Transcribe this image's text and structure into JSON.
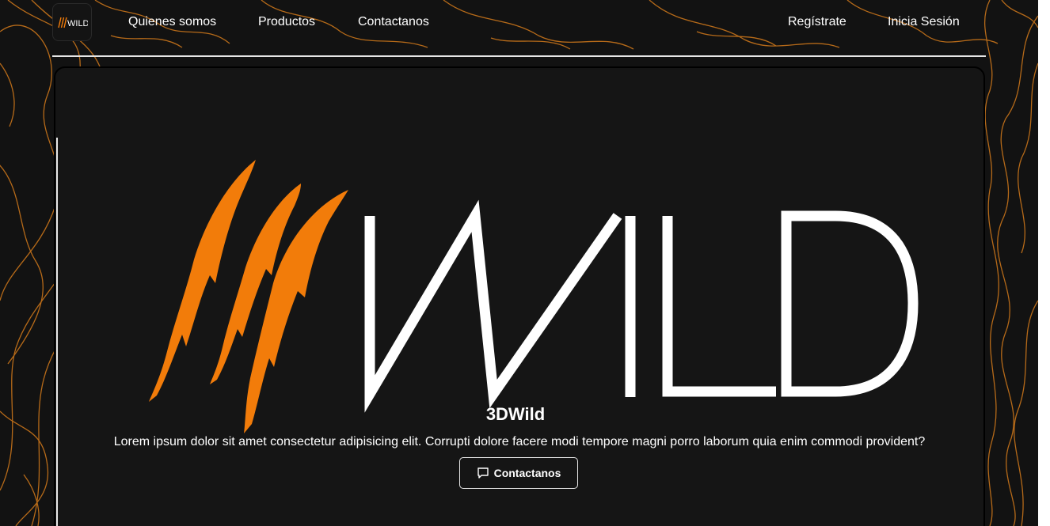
{
  "brand": {
    "logo_text": "WILD",
    "accent_color": "#f27c0a"
  },
  "nav": {
    "links": [
      {
        "label": "Quienes somos"
      },
      {
        "label": "Productos"
      },
      {
        "label": "Contactanos"
      }
    ],
    "register_label": "Regístrate",
    "login_label": "Inicia Sesión"
  },
  "hero": {
    "logo_text": "WILD",
    "title": "3DWild",
    "description": "Lorem ipsum dolor sit amet consectetur adipisicing elit. Corrupti dolore facere modi tempore magni porro laborum quia enim commodi provident?",
    "button_label": "Contactanos",
    "button_icon": "chat-bubble-icon"
  }
}
